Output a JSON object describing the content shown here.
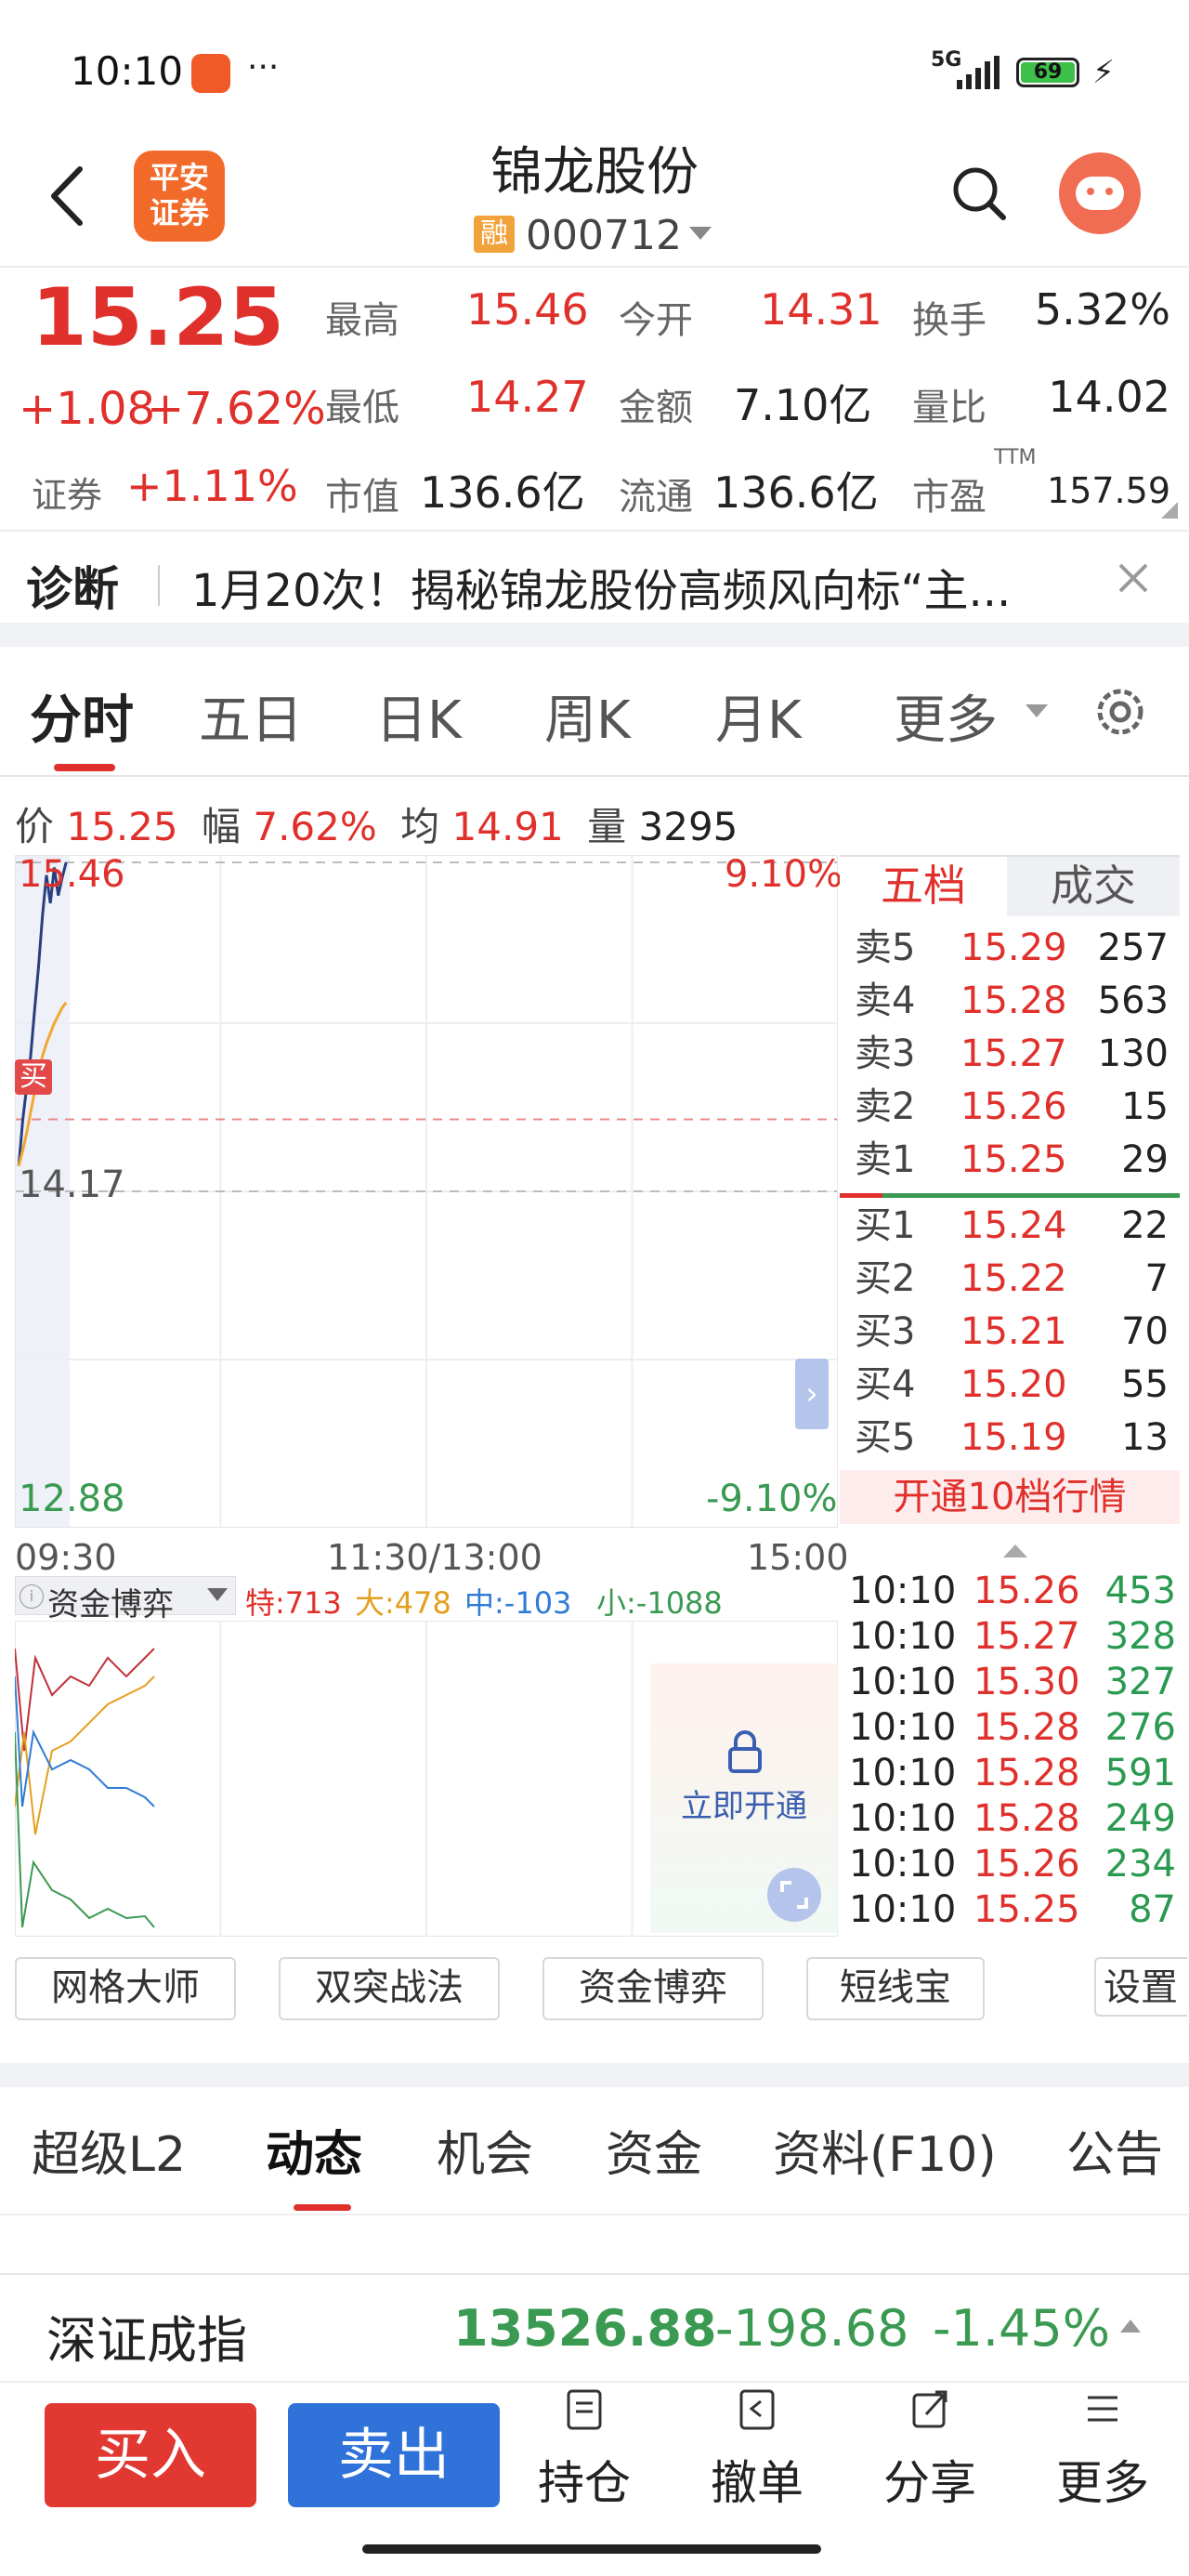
{
  "status_bar": {
    "time": "10:10",
    "signal": "5G",
    "battery": "69"
  },
  "header": {
    "broker_logo_line1": "平安",
    "broker_logo_line2": "证券",
    "stock_name": "锦龙股份",
    "margin_badge": "融",
    "stock_code": "000712"
  },
  "quote": {
    "price": "15.25",
    "change": "+1.08",
    "change_pct": "+7.62%",
    "sector_label": "证券",
    "sector_change": "+1.11%",
    "stats": [
      {
        "label": "最高",
        "value": "15.46"
      },
      {
        "label": "今开",
        "value": "14.31"
      },
      {
        "label": "换手",
        "value": "5.32%"
      },
      {
        "label": "最低",
        "value": "14.27"
      },
      {
        "label": "金额",
        "value": "7.10亿"
      },
      {
        "label": "量比",
        "value": "14.02"
      },
      {
        "label": "市值",
        "value": "136.6亿"
      },
      {
        "label": "流通",
        "value": "136.6亿"
      },
      {
        "label": "市盈",
        "value": "157.59"
      }
    ],
    "pe_superscript": "TTM"
  },
  "diagnosis": {
    "label": "诊断",
    "text": "1月20次！揭秘锦龙股份高频风向标“主..."
  },
  "chart_tabs": [
    "分时",
    "五日",
    "日K",
    "周K",
    "月K",
    "更多"
  ],
  "chart_info": {
    "price_label": "价",
    "price": "15.25",
    "amp_label": "幅",
    "amp": "7.62%",
    "avg_label": "均",
    "avg": "14.91",
    "vol_label": "量",
    "vol": "3295"
  },
  "chart_axis": {
    "top_price": "15.46",
    "top_pct": "9.10%",
    "mid_price": "14.17",
    "bottom_price": "12.88",
    "bottom_pct": "-9.10%",
    "times": [
      "09:30",
      "11:30/13:00",
      "15:00"
    ],
    "buy_marker": "买"
  },
  "chart_data": {
    "type": "line",
    "x": [
      "09:30",
      "09:31",
      "09:32",
      "09:33",
      "09:34",
      "09:35",
      "09:36",
      "09:37",
      "09:38",
      "09:39",
      "09:40",
      "09:41",
      "09:42"
    ],
    "series": [
      {
        "name": "价",
        "values": [
          14.27,
          14.45,
          14.58,
          14.7,
          14.88,
          15.05,
          15.25,
          15.41,
          15.3,
          15.44,
          15.33,
          15.4,
          15.46
        ]
      },
      {
        "name": "均",
        "values": [
          14.27,
          14.33,
          14.4,
          14.48,
          14.56,
          14.63,
          14.7,
          14.75,
          14.79,
          14.83,
          14.86,
          14.89,
          14.91
        ]
      }
    ],
    "ylim": [
      12.88,
      15.46
    ]
  },
  "orderbook": {
    "tab_active": "五档",
    "tab_other": "成交",
    "rows": [
      {
        "label": "卖5",
        "price": "15.29",
        "vol": "257"
      },
      {
        "label": "卖4",
        "price": "15.28",
        "vol": "563"
      },
      {
        "label": "卖3",
        "price": "15.27",
        "vol": "130"
      },
      {
        "label": "卖2",
        "price": "15.26",
        "vol": "15"
      },
      {
        "label": "卖1",
        "price": "15.25",
        "vol": "29"
      },
      {
        "label": "买1",
        "price": "15.24",
        "vol": "22"
      },
      {
        "label": "买2",
        "price": "15.22",
        "vol": "7"
      },
      {
        "label": "买3",
        "price": "15.21",
        "vol": "70"
      },
      {
        "label": "买4",
        "price": "15.20",
        "vol": "55"
      },
      {
        "label": "买5",
        "price": "15.19",
        "vol": "13"
      }
    ],
    "upgrade_button": "开通10档行情"
  },
  "fund_game": {
    "title": "资金博弈",
    "te": "特:713",
    "da": "大:478",
    "zhong": "中:-103",
    "xiao": "小:-1088",
    "unlock": "立即开通"
  },
  "ticks": [
    {
      "time": "10:10",
      "price": "15.26",
      "vol": "453"
    },
    {
      "time": "10:10",
      "price": "15.27",
      "vol": "328"
    },
    {
      "time": "10:10",
      "price": "15.30",
      "vol": "327"
    },
    {
      "time": "10:10",
      "price": "15.28",
      "vol": "276"
    },
    {
      "time": "10:10",
      "price": "15.28",
      "vol": "591"
    },
    {
      "time": "10:10",
      "price": "15.28",
      "vol": "249"
    },
    {
      "time": "10:10",
      "price": "15.26",
      "vol": "234"
    },
    {
      "time": "10:10",
      "price": "15.25",
      "vol": "87"
    }
  ],
  "tools": [
    "网格大师",
    "双突战法",
    "资金博弈",
    "短线宝",
    "设置"
  ],
  "bottom_tabs": [
    "超级L2",
    "动态",
    "机会",
    "资金",
    "资料(F10)",
    "公告"
  ],
  "index_bar": {
    "name": "深证成指",
    "value": "13526.88",
    "change": "-198.68",
    "pct": "-1.45%"
  },
  "actions": {
    "buy": "买入",
    "sell": "卖出",
    "items": [
      "持仓",
      "撤单",
      "分享",
      "更多"
    ]
  }
}
